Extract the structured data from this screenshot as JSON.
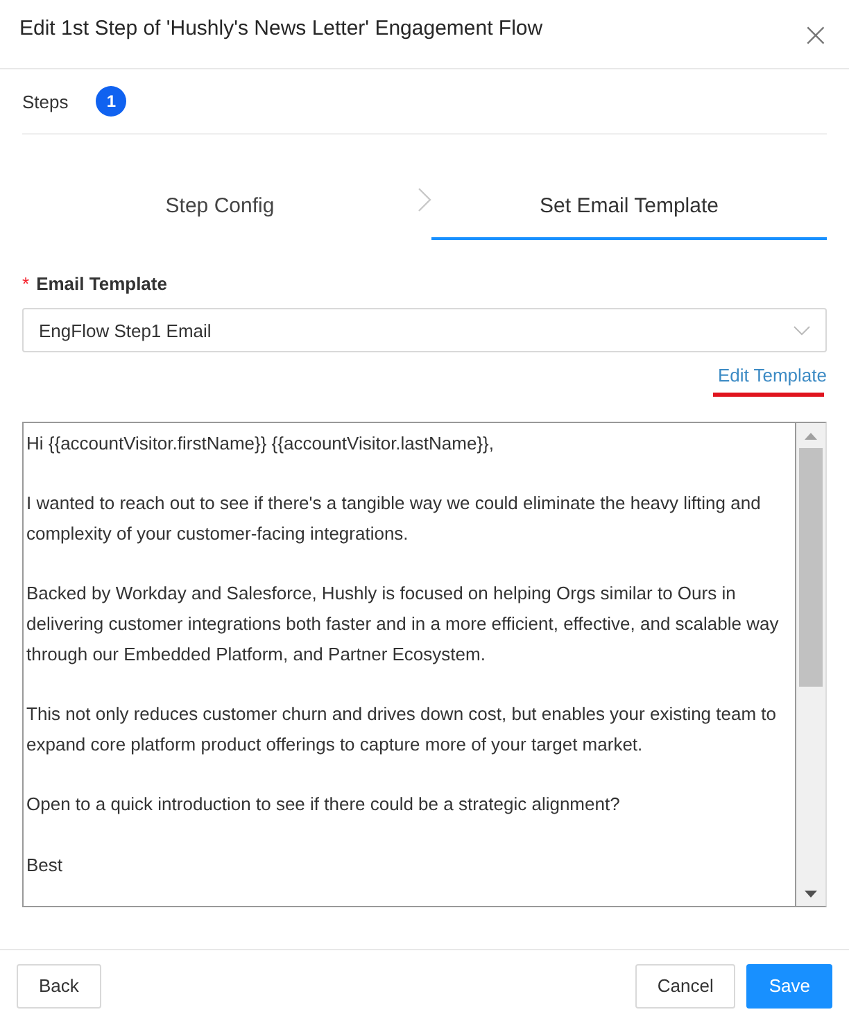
{
  "dialog": {
    "title": "Edit 1st Step of 'Hushly's News Letter' Engagement Flow",
    "close": "×"
  },
  "steps": {
    "label": "Steps",
    "badge": "1"
  },
  "tabs": [
    {
      "label": "Step Config",
      "selected": false
    },
    {
      "label": "Set Email Template",
      "selected": true
    }
  ],
  "form": {
    "label": "Email Template",
    "required_mark": "*",
    "select_value": "EngFlow Step1 Email",
    "link": "Edit Template",
    "body": [
      "Hi {{accountVisitor.firstName}} {{accountVisitor.lastName}},",
      "I wanted to reach out to see if there's a tangible way we could eliminate the heavy lifting and complexity of your customer-facing integrations.",
      "Backed by Workday and Salesforce, Hushly is focused on helping Orgs similar to Ours in delivering customer integrations both faster and in a more efficient, effective, and scalable way through our Embedded Platform, and Partner Ecosystem.",
      "This not only reduces customer churn and drives down cost, but enables your existing team to expand core platform product offerings to capture more of your target market.",
      "Open to a quick introduction to see if there could be a strategic alignment?",
      "Best"
    ]
  },
  "footer": {
    "back": "Back",
    "cancel": "Cancel",
    "save": "Save"
  }
}
